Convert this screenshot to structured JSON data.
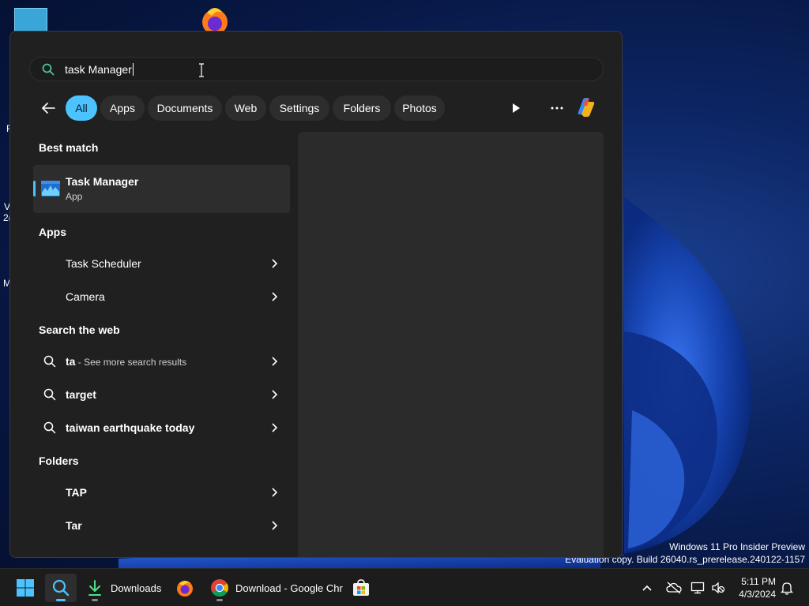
{
  "search": {
    "query": "task Manager"
  },
  "filters": {
    "chips": [
      "All",
      "Apps",
      "Documents",
      "Web",
      "Settings",
      "Folders",
      "Photos"
    ],
    "active": "All"
  },
  "best_match": {
    "heading": "Best match",
    "title": "Task Manager",
    "subtitle": "App"
  },
  "apps": {
    "heading": "Apps",
    "items": [
      {
        "label": "Task Scheduler"
      },
      {
        "label": "Camera"
      }
    ]
  },
  "web": {
    "heading": "Search the web",
    "items": [
      {
        "label": "ta",
        "sub": " - See more search results"
      },
      {
        "label": "target"
      },
      {
        "label": "taiwan earthquake today"
      }
    ]
  },
  "folders": {
    "heading": "Folders",
    "items": [
      {
        "label": "TAP"
      },
      {
        "label": "Tar"
      }
    ]
  },
  "watermark": {
    "line1": "Windows 11 Pro Insider Preview",
    "line2": "Evaluation copy. Build 26040.rs_prerelease.240122-1157"
  },
  "desktop": {
    "left_labels": [
      "F",
      "V",
      "2(",
      "M"
    ]
  },
  "taskbar": {
    "downloads_label": "Downloads",
    "chrome_label": "Download - Google Chr",
    "time": "5:11 PM",
    "date": "4/3/2024"
  },
  "colors": {
    "accent": "#4cc2ff",
    "panel": "#202020",
    "preview": "#2b2b2b"
  }
}
